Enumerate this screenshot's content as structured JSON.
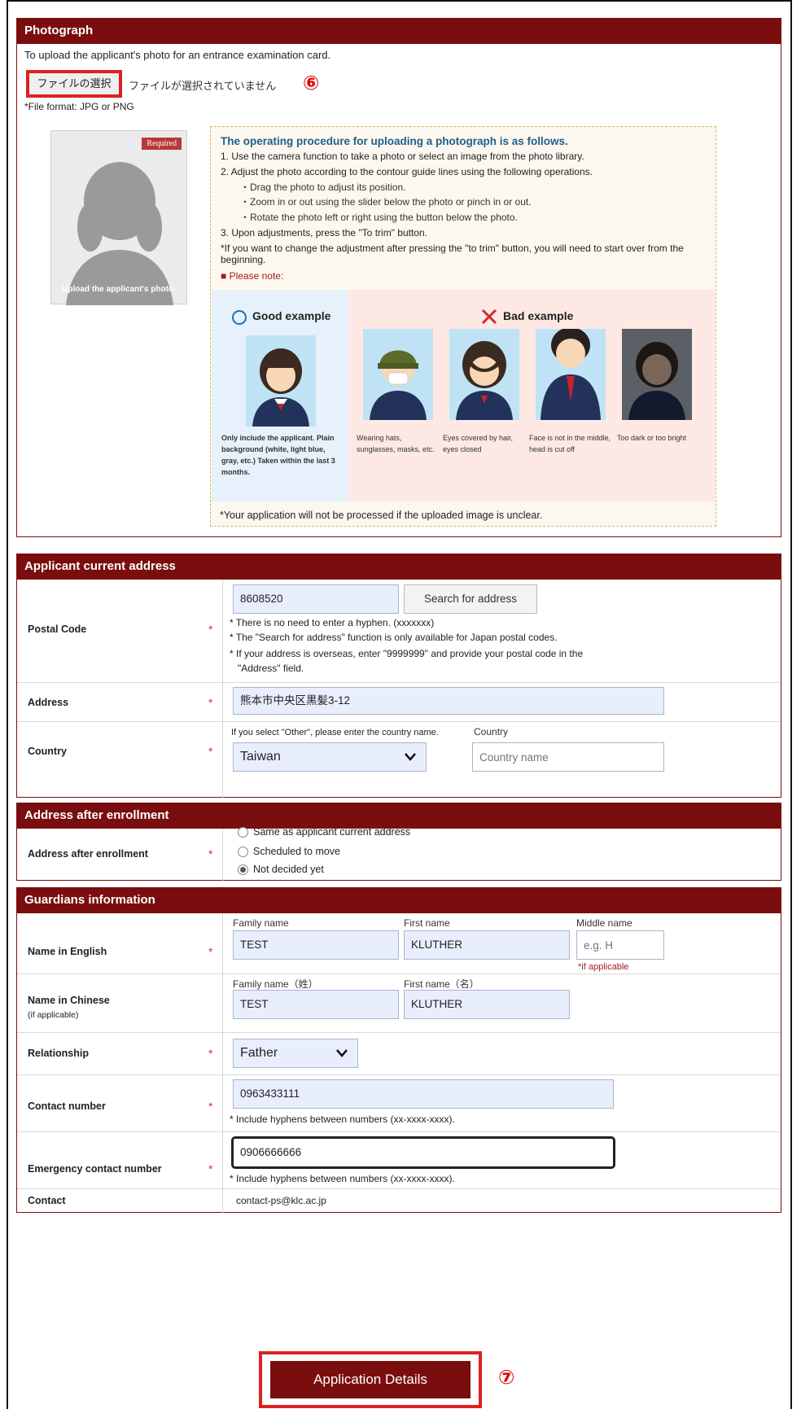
{
  "photo_section": {
    "title": "Photograph",
    "description": "To upload the applicant's photo for an entrance examination card.",
    "choose_file_label": "ファイルの選択",
    "no_file_label": "ファイルが選択されていません",
    "marker_6": "⑥",
    "file_format": "*File format: JPG or PNG",
    "required_tag": "Required",
    "placeholder_caption": "Upload the applicant's photo."
  },
  "procedure": {
    "title": "The operating procedure for uploading a photograph is as follows.",
    "step1": "1. Use the camera function to take a photo or select an image from the photo library.",
    "step2": "2. Adjust the photo according to the contour guide lines using the following operations.",
    "step2a": "・Drag the photo to adjust its position.",
    "step2b": "・Zoom in or out using the slider below the photo or pinch in or out.",
    "step2c": "・Rotate the photo left or right using the button below the photo.",
    "step3": "3. Upon adjustments, press the \"To trim\" button.",
    "step_note": "*If you want to change the adjustment after pressing the \"to trim\" button, you will need to start over from the beginning.",
    "please_note": "■ Please note:",
    "good_title": "Good example",
    "bad_title": "Bad example",
    "good_caption": "Only include the applicant. Plain background (white, light blue, gray, etc.) Taken within the last 3 months.",
    "bad_caption_1": "Wearing hats, sunglasses, masks, etc.",
    "bad_caption_2": "Eyes covered by hair, eyes closed",
    "bad_caption_3": "Face is not in the middle, head is cut off",
    "bad_caption_4": "Too dark or too bright",
    "final_note": "*Your application will not be processed if the uploaded image is unclear."
  },
  "address_section": {
    "title": "Applicant current address",
    "postal_label": "Postal Code",
    "postal_value": "8608520",
    "search_button": "Search for address",
    "postal_hint_1": "* There is no need to enter a hyphen. (xxxxxxx)",
    "postal_hint_2": "* The \"Search for address\" function is only available for Japan postal codes.",
    "postal_hint_3": "* If your address is overseas, enter \"9999999\" and provide your postal code in the",
    "postal_hint_4": "\"Address\" field.",
    "address_label": "Address",
    "address_value": "熊本市中央区黒髪3-12",
    "country_label": "Country",
    "country_hint": "If you select \"Other\", please enter the country name.",
    "country_sub_label": "Country",
    "country_value": "Taiwan",
    "country_name_placeholder": "Country name"
  },
  "enroll_section": {
    "title": "Address after enrollment",
    "label": "Address after enrollment",
    "options": [
      "Same as applicant current address",
      "Scheduled to move",
      "Not decided yet"
    ],
    "selected": "Not decided yet"
  },
  "guardian_section": {
    "title": "Guardians information",
    "name_en_label": "Name in English",
    "family_name_label": "Family name",
    "first_name_label": "First name",
    "middle_name_label": "Middle name",
    "family_name_value": "TEST",
    "first_name_value": "KLUTHER",
    "middle_name_placeholder": "e.g. H",
    "if_applicable": "*if applicable",
    "name_cn_label": "Name in Chinese",
    "name_cn_sub": "(if applicable)",
    "family_name_cn_label": "Family name（姓）",
    "first_name_cn_label": "First name（名）",
    "family_name_cn_value": "TEST",
    "first_name_cn_value": "KLUTHER",
    "relationship_label": "Relationship",
    "relationship_value": "Father",
    "contact_label": "Contact number",
    "contact_value": "0963433111",
    "contact_hint": "* Include hyphens between numbers (xx-xxxx-xxxx).",
    "emergency_label": "Emergency contact number",
    "emergency_value": "0906666666",
    "emergency_hint": "* Include hyphens between numbers (xx-xxxx-xxxx).",
    "contact_info_label": "Contact",
    "contact_info_value": "contact-ps@klc.ac.jp"
  },
  "footer": {
    "application_button": "Application Details",
    "marker_7": "⑦"
  },
  "colors": {
    "header_bg": "#7a0e0e",
    "highlight": "#e02020",
    "required": "#c33333"
  }
}
